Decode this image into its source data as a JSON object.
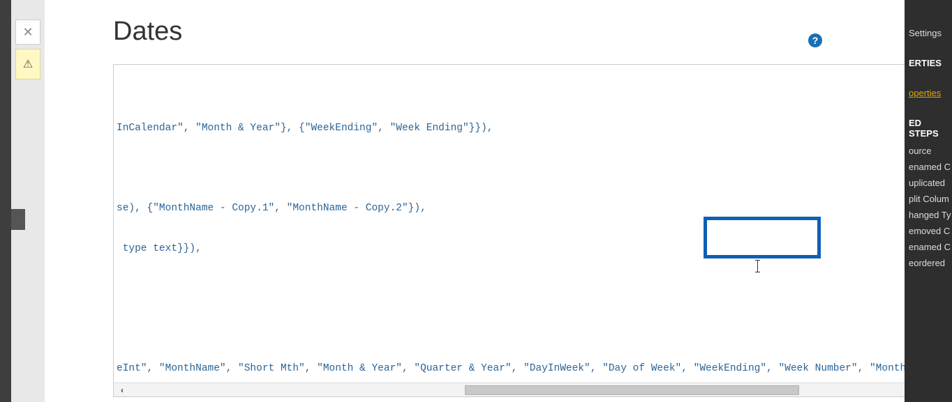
{
  "page_title": "Dates",
  "help_tooltip": "?",
  "code_lines": {
    "line1": "InCalendar\", \"Month & Year\"}, {\"WeekEnding\", \"Week Ending\"}}),",
    "line2": "se), {\"MonthName - Copy.1\", \"MonthName - Copy.2\"}),",
    "line3": " type text}}),",
    "line4": "eInt\", \"MonthName\", \"Short Mth\", \"Month & Year\", \"Quarter & Year\", \"DayInWeek\", \"Day of Week\", \"WeekEnding\", \"Week Number\", \"MonthnYear\", \"Quar"
  },
  "right_panel": {
    "settings": "Settings",
    "properties_header": "ERTIES",
    "properties_link": "operties",
    "steps_header": "ED STEPS",
    "steps": [
      "ource",
      "enamed C",
      "uplicated",
      "plit Colum",
      "hanged Ty",
      "emoved C",
      "enamed C",
      "eordered "
    ]
  },
  "tab_close": "✕",
  "tab_warn": "⚠"
}
